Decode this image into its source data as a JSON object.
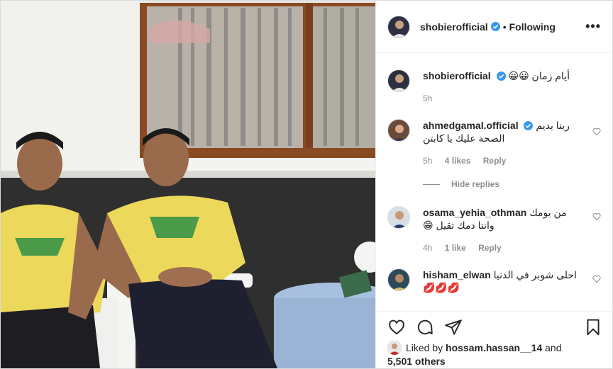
{
  "post": {
    "author": "shobierofficial",
    "follow_state": "Following",
    "separator": "•",
    "more_label": "•••",
    "caption": {
      "username": "shobierofficial",
      "text": "أيام زمان 😀😀",
      "time": "5h"
    }
  },
  "comments": [
    {
      "username": "ahmedgamal.official",
      "verified": true,
      "text": "ربنا يديم الصحة عليك يا كابتن",
      "time": "5h",
      "likes": "4 likes",
      "reply": "Reply"
    },
    {
      "username": "osama_yehia_othman",
      "verified": false,
      "text": "من يومك وانتا دمك تقيل 😁",
      "time": "4h",
      "likes": "1 like",
      "reply": "Reply"
    },
    {
      "username": "hisham_elwan",
      "verified": false,
      "text": "احلى شوبر في الدنيا 💋💋💋"
    }
  ],
  "hide_replies": "Hide replies",
  "liked_by": {
    "prefix": "Liked by",
    "user": "hossam.hassan__14",
    "and": "and",
    "others": "5,501 others"
  },
  "icons": {
    "like": "heart-icon",
    "comment": "comment-icon",
    "share": "share-icon",
    "save": "bookmark-icon",
    "verified": "verified-badge-icon",
    "more": "more-options-icon"
  },
  "colors": {
    "verified_blue": "#3897f0",
    "text": "#262626",
    "muted": "#8e8e8e",
    "border": "#dbdbdb"
  }
}
